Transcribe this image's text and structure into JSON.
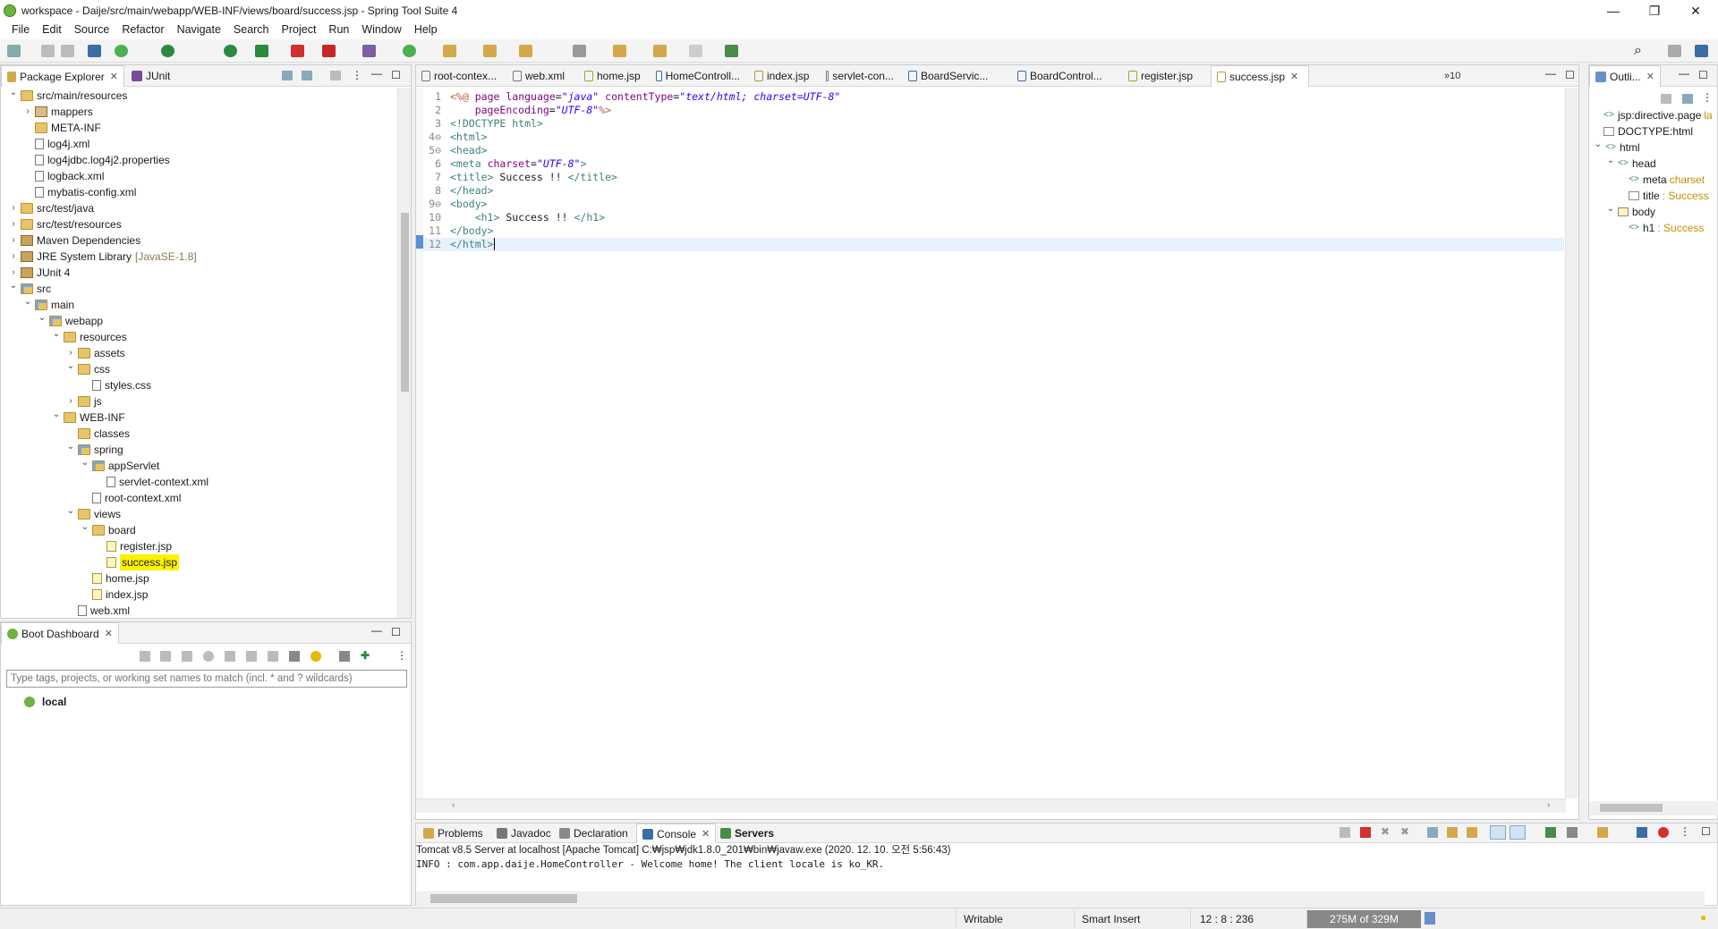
{
  "window": {
    "title": "workspace - Daije/src/main/webapp/WEB-INF/views/board/success.jsp - Spring Tool Suite 4"
  },
  "menu": [
    "File",
    "Edit",
    "Source",
    "Refactor",
    "Navigate",
    "Search",
    "Project",
    "Run",
    "Window",
    "Help"
  ],
  "explorer": {
    "tabs": [
      {
        "label": "Package Explorer",
        "close": "✕"
      },
      {
        "label": "JUnit"
      }
    ],
    "rows": [
      {
        "depth": 1,
        "twisty": "v",
        "icon": "folder",
        "label": "src/main/resources"
      },
      {
        "depth": 2,
        "twisty": ">",
        "icon": "pkg",
        "label": "mappers"
      },
      {
        "depth": 2,
        "twisty": "",
        "icon": "folder",
        "label": "META-INF"
      },
      {
        "depth": 2,
        "twisty": "",
        "icon": "xml",
        "label": "log4j.xml"
      },
      {
        "depth": 2,
        "twisty": "",
        "icon": "file",
        "label": "log4jdbc.log4j2.properties"
      },
      {
        "depth": 2,
        "twisty": "",
        "icon": "xml",
        "label": "logback.xml"
      },
      {
        "depth": 2,
        "twisty": "",
        "icon": "xml",
        "label": "mybatis-config.xml"
      },
      {
        "depth": 1,
        "twisty": ">",
        "icon": "folder",
        "label": "src/test/java"
      },
      {
        "depth": 1,
        "twisty": ">",
        "icon": "folder",
        "label": "src/test/resources"
      },
      {
        "depth": 1,
        "twisty": ">",
        "icon": "lib",
        "label": "Maven Dependencies"
      },
      {
        "depth": 1,
        "twisty": ">",
        "icon": "lib",
        "label": "JRE System Library",
        "suffix": "[JavaSE-1.8]"
      },
      {
        "depth": 1,
        "twisty": ">",
        "icon": "lib",
        "label": "JUnit 4"
      },
      {
        "depth": 1,
        "twisty": "v",
        "icon": "pkgfolder",
        "label": "src"
      },
      {
        "depth": 2,
        "twisty": "v",
        "icon": "pkgfolder",
        "label": "main"
      },
      {
        "depth": 3,
        "twisty": "v",
        "icon": "pkgfolder",
        "label": "webapp"
      },
      {
        "depth": 4,
        "twisty": "v",
        "icon": "folder",
        "label": "resources"
      },
      {
        "depth": 5,
        "twisty": ">",
        "icon": "folder",
        "label": "assets"
      },
      {
        "depth": 5,
        "twisty": "v",
        "icon": "folder",
        "label": "css"
      },
      {
        "depth": 6,
        "twisty": "",
        "icon": "file",
        "label": "styles.css"
      },
      {
        "depth": 5,
        "twisty": ">",
        "icon": "folder",
        "label": "js"
      },
      {
        "depth": 4,
        "twisty": "v",
        "icon": "folder",
        "label": "WEB-INF"
      },
      {
        "depth": 5,
        "twisty": "",
        "icon": "folder",
        "label": "classes"
      },
      {
        "depth": 5,
        "twisty": "v",
        "icon": "pkgfolder",
        "label": "spring"
      },
      {
        "depth": 6,
        "twisty": "v",
        "icon": "pkgfolder",
        "label": "appServlet"
      },
      {
        "depth": 7,
        "twisty": "",
        "icon": "xml",
        "label": "servlet-context.xml"
      },
      {
        "depth": 6,
        "twisty": "",
        "icon": "xml",
        "label": "root-context.xml"
      },
      {
        "depth": 5,
        "twisty": "v",
        "icon": "folder",
        "label": "views"
      },
      {
        "depth": 6,
        "twisty": "v",
        "icon": "folder",
        "label": "board"
      },
      {
        "depth": 7,
        "twisty": "",
        "icon": "jsp",
        "label": "register.jsp"
      },
      {
        "depth": 7,
        "twisty": "",
        "icon": "jsp",
        "label": "success.jsp",
        "selected": true
      },
      {
        "depth": 6,
        "twisty": "",
        "icon": "jsp",
        "label": "home.jsp"
      },
      {
        "depth": 6,
        "twisty": "",
        "icon": "jsp",
        "label": "index.jsp"
      },
      {
        "depth": 5,
        "twisty": "",
        "icon": "xml",
        "label": "web.xml"
      }
    ]
  },
  "boot": {
    "tab": "Boot Dashboard",
    "filter_placeholder": "Type tags, projects, or working set names to match (incl. * and ? wildcards)",
    "items": [
      {
        "label": "local"
      }
    ]
  },
  "editor": {
    "tabs": [
      {
        "label": "root-contex...",
        "icon": "xml"
      },
      {
        "label": "web.xml",
        "icon": "xml"
      },
      {
        "label": "home.jsp",
        "icon": "jsp"
      },
      {
        "label": "HomeControll...",
        "icon": "java"
      },
      {
        "label": "index.jsp",
        "icon": "jsp"
      },
      {
        "label": "servlet-con...",
        "icon": "xml"
      },
      {
        "label": "BoardServic...",
        "icon": "java"
      },
      {
        "label": "BoardControl...",
        "icon": "java"
      },
      {
        "label": "register.jsp",
        "icon": "jsp"
      },
      {
        "label": "success.jsp",
        "icon": "jsp",
        "active": true
      }
    ],
    "overflow": "»10",
    "lines": [
      {
        "n": "1",
        "html": "<span class='dir'>&lt;%@</span> <span class='attr'>page</span> <span class='attr'>language</span>=<span class='str'>\"java\"</span> <span class='attr'>contentType</span>=<span class='str'>\"text/html; charset=UTF-8\"</span>"
      },
      {
        "n": "2",
        "html": "    <span class='attr'>pageEncoding</span>=<span class='str'>\"UTF-8\"</span><span class='dir'>%&gt;</span>"
      },
      {
        "n": "3",
        "html": "<span class='tag'>&lt;!DOCTYPE html&gt;</span>"
      },
      {
        "n": "4⊖",
        "html": "<span class='tag'>&lt;html&gt;</span>"
      },
      {
        "n": "5⊖",
        "html": "<span class='tag'>&lt;head&gt;</span>"
      },
      {
        "n": "6",
        "html": "<span class='tag'>&lt;meta</span> <span class='attr'>charset</span>=<span class='str'>\"UTF-8\"</span><span class='tag'>&gt;</span>"
      },
      {
        "n": "7",
        "html": "<span class='tag'>&lt;title&gt;</span> Success !! <span class='tag'>&lt;/title&gt;</span>"
      },
      {
        "n": "8",
        "html": "<span class='tag'>&lt;/head&gt;</span>"
      },
      {
        "n": "9⊖",
        "html": "<span class='tag'>&lt;body&gt;</span>"
      },
      {
        "n": "10",
        "html": "    <span class='tag'>&lt;h1&gt;</span> Success !! <span class='tag'>&lt;/h1&gt;</span>"
      },
      {
        "n": "11",
        "html": "<span class='tag'>&lt;/body&gt;</span>"
      },
      {
        "n": "12",
        "html": "<span class='tag'>&lt;/html&gt;</span>"
      }
    ]
  },
  "outline": {
    "tab": "Outli...",
    "rows": [
      {
        "depth": 0,
        "twisty": "",
        "icon": "<>",
        "label": "jsp:directive.page",
        "suffix": "la"
      },
      {
        "depth": 0,
        "twisty": "",
        "icon": "doc",
        "label": "DOCTYPE:html"
      },
      {
        "depth": 0,
        "twisty": "v",
        "icon": "<>",
        "label": "html"
      },
      {
        "depth": 1,
        "twisty": "v",
        "icon": "<>",
        "label": "head"
      },
      {
        "depth": 2,
        "twisty": "",
        "icon": "<>",
        "label": "meta",
        "suffix": "charset"
      },
      {
        "depth": 2,
        "twisty": "",
        "icon": "title",
        "label": "title",
        "suffix": ": Success"
      },
      {
        "depth": 1,
        "twisty": "v",
        "icon": "body",
        "label": "body"
      },
      {
        "depth": 2,
        "twisty": "",
        "icon": "<>",
        "label": "h1",
        "suffix": ": Success"
      }
    ]
  },
  "console": {
    "tabs": [
      "Problems",
      "Javadoc",
      "Declaration",
      "Console",
      "Servers"
    ],
    "header": "Tomcat v8.5 Server at localhost [Apache Tomcat] C:₩jsp₩jdk1.8.0_201₩bin₩javaw.exe  (2020. 12. 10. 오전 5:56:43)",
    "output": "INFO : com.app.daije.HomeController - Welcome home! The client locale is ko_KR."
  },
  "status": {
    "writable": "Writable",
    "insert": "Smart Insert",
    "position": "12 : 8 : 236",
    "heap": "275M of 329M"
  },
  "colors": {
    "accent_green": "#6db33f",
    "selection_yellow": "#fff200",
    "current_line": "#e8f2fe"
  }
}
